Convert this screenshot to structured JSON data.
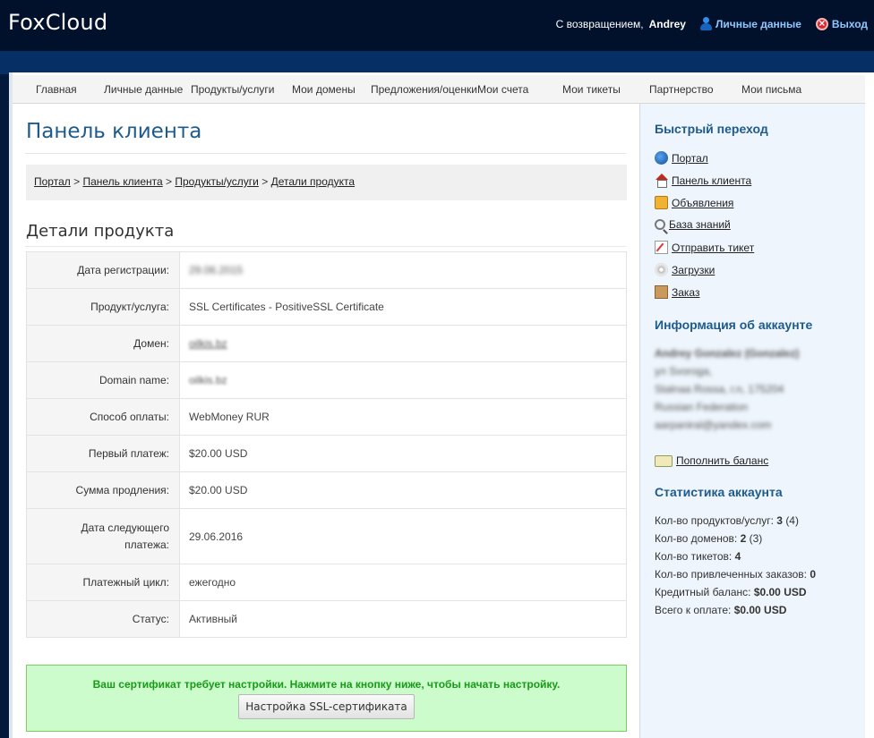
{
  "header": {
    "logo": "FoxCloud",
    "welcome_text": "С возвращением,",
    "user_name": "Andrey",
    "account_link": "Личные данные",
    "logout_link": "Выход"
  },
  "nav": {
    "items": [
      "Главная",
      "Личные данные",
      "Продукты/услуги",
      "Мои домены",
      "Предложения/оценки",
      "Мои счета",
      "Мои тикеты",
      "Партнерство",
      "Мои письма"
    ]
  },
  "main": {
    "page_title": "Панель клиента",
    "breadcrumb": {
      "items": [
        "Портал",
        "Панель клиента",
        "Продукты/услуги",
        "Детали продукта"
      ],
      "separator": ">"
    },
    "section_title": "Детали продукта",
    "details": [
      {
        "label": "Дата регистрации:",
        "value": "29.06.2015"
      },
      {
        "label": "Продукт/услуга:",
        "value": "SSL Certificates - PositiveSSL Certificate"
      },
      {
        "label": "Домен:",
        "value": "oilkis.bz"
      },
      {
        "label": "Domain name:",
        "value": "oilkis.bz"
      },
      {
        "label": "Способ оплаты:",
        "value": "WebMoney RUR"
      },
      {
        "label": "Первый платеж:",
        "value": "$20.00 USD"
      },
      {
        "label": "Сумма продления:",
        "value": "$20.00 USD"
      },
      {
        "label": "Дата следующего платежа:",
        "value": "29.06.2016"
      },
      {
        "label": "Платежный цикл:",
        "value": "ежегодно"
      },
      {
        "label": "Статус:",
        "value": "Активный"
      }
    ],
    "ssl_message": "Ваш сертификат требует настройки. Нажмите на кнопку ниже, чтобы начать настройку.",
    "ssl_button": "Настройка SSL-сертификата"
  },
  "sidebar": {
    "quick_title": "Быстрый переход",
    "quick_links": [
      {
        "label": "Портал",
        "icon": "globe-icon"
      },
      {
        "label": "Панель клиента",
        "icon": "home-icon"
      },
      {
        "label": "Объявления",
        "icon": "announcements-icon"
      },
      {
        "label": "База знаний",
        "icon": "knowledgebase-icon"
      },
      {
        "label": "Отправить тикет",
        "icon": "ticket-icon"
      },
      {
        "label": "Загрузки",
        "icon": "downloads-icon"
      },
      {
        "label": "Заказ",
        "icon": "order-icon"
      }
    ],
    "account_title": "Информация об аккаунте",
    "account_lines": [
      "Andrey Gonzalez (Gonzalez)",
      "ул Svoroga,",
      "Stalnaa Rossa, г.n, 175204",
      "Russian Federation",
      "aarpaniral@yandex.com"
    ],
    "add_funds": "Пополнить баланс",
    "stats_title": "Статистика аккаунта",
    "stats": [
      {
        "label": "Кол-во продуктов/услуг:",
        "value": "3",
        "extra": "(4)"
      },
      {
        "label": "Кол-во доменов:",
        "value": "2",
        "extra": "(3)"
      },
      {
        "label": "Кол-во тикетов:",
        "value": "4",
        "extra": ""
      },
      {
        "label": "Кол-во привлеченных заказов:",
        "value": "0",
        "extra": ""
      },
      {
        "label": "Кредитный баланс:",
        "value": "$0.00 USD",
        "extra": ""
      },
      {
        "label": "Всего к оплате:",
        "value": "$0.00 USD",
        "extra": ""
      }
    ]
  }
}
